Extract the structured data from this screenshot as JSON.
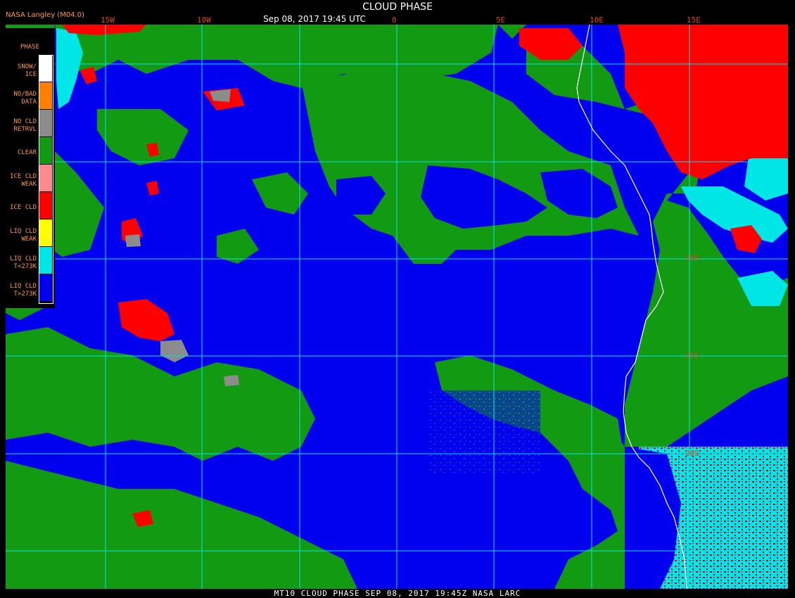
{
  "header": {
    "credit": "NASA Langley (M04.0)",
    "title": "CLOUD PHASE",
    "timestamp": "Sep 08, 2017 19:45 UTC"
  },
  "grid": {
    "longitudes": [
      "15W",
      "10W",
      "0",
      "5E",
      "10E",
      "15E"
    ],
    "latitudes": [
      "10S",
      "15S",
      "20S"
    ]
  },
  "legend": {
    "heading": "PHASE",
    "items": [
      {
        "label": "SNOW/\nICE",
        "color": "#ffffff"
      },
      {
        "label": "NO/BAD\nDATA",
        "color": "#ff7f00"
      },
      {
        "label": "NO CLD\nRETRVL",
        "color": "#8c8c8c"
      },
      {
        "label": "CLEAR",
        "color": "#139a13"
      },
      {
        "label": "ICE CLD\nWEAK",
        "color": "#ff8c8c"
      },
      {
        "label": "ICE CLD",
        "color": "#ff0000"
      },
      {
        "label": "LIQ CLD\nWEAK",
        "color": "#ffff00"
      },
      {
        "label": "LIQ CLD\nT<273K",
        "color": "#00e5e5"
      },
      {
        "label": "LIQ CLD\nT>273K",
        "color": "#0000ee"
      }
    ]
  },
  "footer": {
    "caption": "MT10  CLOUD PHASE  SEP 08, 2017 19:45Z  NASA LARC"
  },
  "colors": {
    "clear": "#139a13",
    "liquid_warm": "#0000ee",
    "liquid_cold": "#00e5e5",
    "ice": "#ff0000",
    "no_retrieval": "#8c8c8c",
    "grid": "#00e5e5",
    "coastline": "#ffffff"
  }
}
